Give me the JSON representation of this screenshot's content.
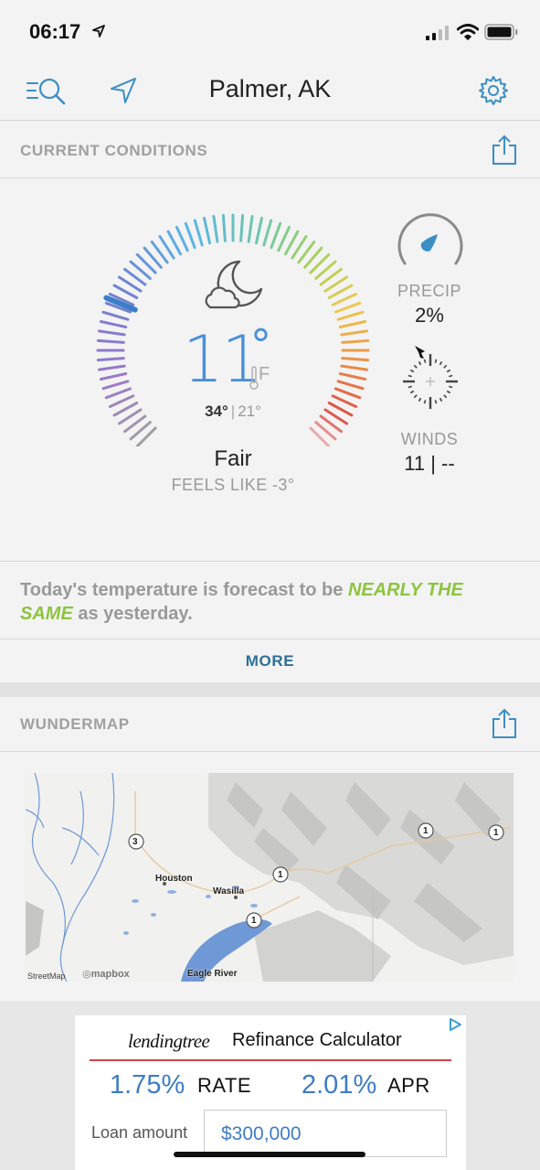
{
  "status_bar": {
    "time": "06:17"
  },
  "nav": {
    "title": "Palmer, AK"
  },
  "current_conditions": {
    "header": "CURRENT CONDITIONS",
    "temperature": "11",
    "degree": "°",
    "unit": "F",
    "high": "34°",
    "low": "21°",
    "separator": "|",
    "condition": "Fair",
    "feels_like": "FEELS LIKE -3°",
    "precip_label": "PRECIP",
    "precip_value": "2%",
    "winds_label": "WINDS",
    "winds_value": "11 | --"
  },
  "summary": {
    "prefix": "Today's temperature is forecast to be ",
    "highlight": "NEARLY THE SAME",
    "suffix": " as yesterday."
  },
  "more_label": "MORE",
  "wundermap": {
    "header": "WUNDERMAP",
    "places": {
      "houston": "Houston",
      "wasilla": "Wasilla",
      "eagle_river": "Eagle River"
    },
    "route_3": "3",
    "route_1": "1",
    "attribution_streetmap": "StreetMap",
    "attribution_mapbox": "mapbox"
  },
  "ad": {
    "logo": "lendingtree",
    "title": "Refinance Calculator",
    "rate_value": "1.75%",
    "rate_label": "RATE",
    "apr_value": "2.01%",
    "apr_label": "APR",
    "loan_label": "Loan amount",
    "loan_value": "$300,000"
  },
  "colors": {
    "accent_blue": "#4a90d9",
    "link_blue": "#2e6f96",
    "highlight_green": "#8cc43f",
    "ad_red": "#d8424b"
  }
}
